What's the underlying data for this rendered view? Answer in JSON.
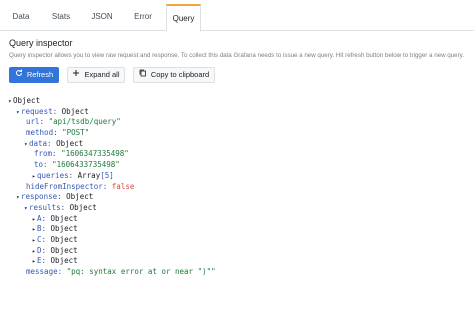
{
  "tabs": [
    {
      "label": "Data"
    },
    {
      "label": "Stats"
    },
    {
      "label": "JSON"
    },
    {
      "label": "Error"
    },
    {
      "label": "Query"
    }
  ],
  "inspector": {
    "title": "Query inspector",
    "description": "Query inspector allows you to view raw request and response. To collect this data Grafana needs to issue a new query. Hit refresh button below to trigger a new query."
  },
  "buttons": {
    "refresh": "Refresh",
    "expand_all": "Expand all",
    "copy": "Copy to clipboard"
  },
  "tree": {
    "root": "Object",
    "request_key": "request:",
    "request_val": "Object",
    "url_key": "url:",
    "url_val": "\"api/tsdb/query\"",
    "method_key": "method:",
    "method_val": "\"POST\"",
    "data_key": "data:",
    "data_val": "Object",
    "from_key": "from:",
    "from_val": "\"1606347335498\"",
    "to_key": "to:",
    "to_val": "\"1606433735498\"",
    "queries_key": "queries:",
    "queries_type": "Array",
    "queries_count": "[5]",
    "hide_key": "hideFromInspector:",
    "hide_val": "false",
    "response_key": "response:",
    "response_val": "Object",
    "results_key": "results:",
    "results_val": "Object",
    "a_key": "A:",
    "a_val": "Object",
    "b_key": "B:",
    "b_val": "Object",
    "c_key": "C:",
    "c_val": "Object",
    "d_key": "D:",
    "d_val": "Object",
    "e_key": "E:",
    "e_val": "Object",
    "message_key": "message:",
    "message_val": "\"pq: syntax error at or near \")\"\""
  }
}
